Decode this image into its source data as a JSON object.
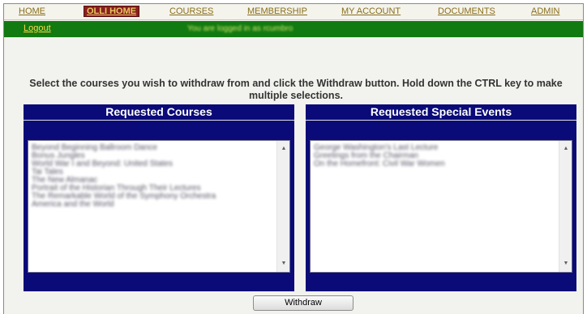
{
  "nav": {
    "items": [
      {
        "label": "HOME"
      },
      {
        "label": "OLLI HOME"
      },
      {
        "label": "COURSES"
      },
      {
        "label": "MEMBERSHIP"
      },
      {
        "label": "MY ACCOUNT"
      },
      {
        "label": "DOCUMENTS"
      },
      {
        "label": "ADMIN"
      }
    ],
    "active": "OLLI HOME"
  },
  "status": {
    "logout_label": "Logout",
    "logged_in_text": "You are logged in as rcumbro"
  },
  "instructions": "Select the courses you wish to withdraw from and click the Withdraw button. Hold down the CTRL key to make multiple selections.",
  "requested_courses": {
    "title": "Requested Courses",
    "items": [
      "Beyond Beginning Ballroom Dance",
      "Bonus Jungles",
      "World War I and Beyond: United States",
      "Tai Tales",
      "The New Almanac",
      "Portrait of the Historian Through Their Lectures",
      "The Remarkable World of the Symphony Orchestra",
      "America and the World"
    ]
  },
  "requested_events": {
    "title": "Requested Special Events",
    "items": [
      "George Washington's Last Lecture",
      "Greetings from the Chairman",
      "On the Homefront: Civil War Women"
    ]
  },
  "withdraw_button": "Withdraw",
  "colors": {
    "panel_bg": "#0a0a78",
    "status_bar": "#117a11",
    "nav_link": "#8a6d1a",
    "active_tab_bg": "#8a1f1f"
  }
}
